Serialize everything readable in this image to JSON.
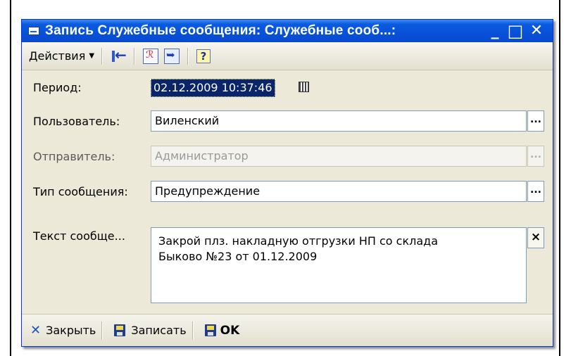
{
  "window": {
    "title": "Запись Служебные сообщения: Служебные сооб...:",
    "buttons": {
      "minimize": "_",
      "maximize": "□",
      "close": "✕"
    }
  },
  "toolbar": {
    "actions_label": "Действия",
    "icons": [
      "exit-icon",
      "document-icon",
      "navigate-icon",
      "help-icon"
    ],
    "help_glyph": "?"
  },
  "form": {
    "period": {
      "label": "Период:",
      "value": "02.12.2009 10:37:46"
    },
    "user": {
      "label": "Пользователь:",
      "value": "Виленский",
      "button": "..."
    },
    "sender": {
      "label": "Отправитель:",
      "value": "Администратор",
      "button": "..."
    },
    "message_type": {
      "label": "Тип сообщения:",
      "value": "Предупреждение",
      "button": "..."
    },
    "message_text": {
      "label": "Текст сообще...",
      "line1": "Закрой плз. накладную отгрузки НП со склада",
      "line2": "Быково №23 от 01.12.2009",
      "clear_button": "×"
    }
  },
  "bottom": {
    "close_label": "Закрыть",
    "save_label": "Записать",
    "ok_label": "OK"
  },
  "colors": {
    "titlebar": "#0a5ae0",
    "window_bg": "#ece9d8",
    "selection": "#0a246a"
  }
}
